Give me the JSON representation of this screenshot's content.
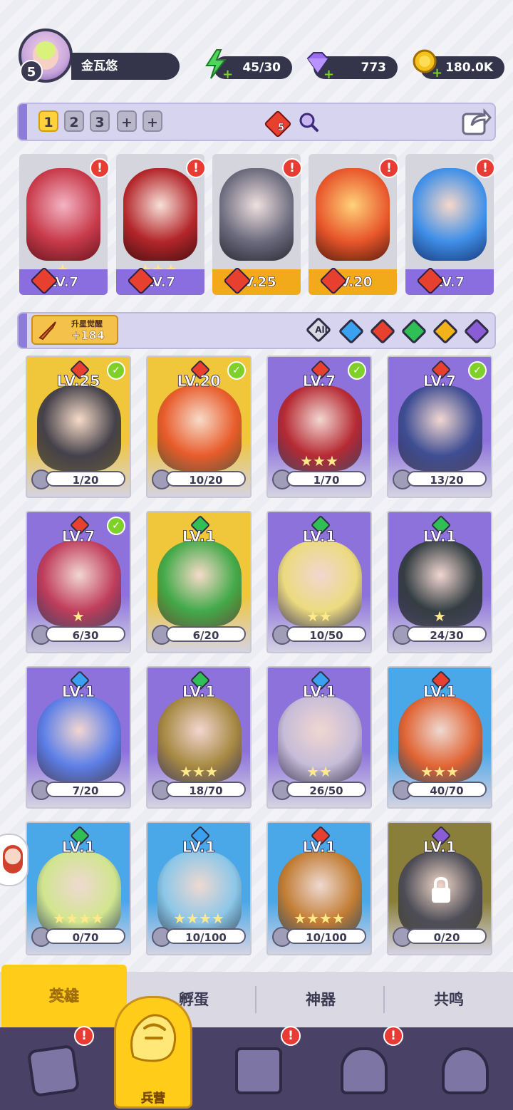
{
  "player": {
    "level": "5",
    "name": "金瓦悠"
  },
  "resources": {
    "energy": "45/30",
    "gems": "773",
    "gold": "180.0K"
  },
  "team_bar": {
    "tabs": [
      "1",
      "2",
      "3",
      "+",
      "+"
    ],
    "active_tab": "1",
    "fire_element_count": "5"
  },
  "team_heroes": [
    {
      "level": "LV.7",
      "bar": "purple",
      "color": "#c83a4a",
      "stars": "★",
      "alert": "!"
    },
    {
      "level": "LV.7",
      "bar": "purple",
      "color": "#b3262a",
      "stars": "★★★",
      "alert": "!"
    },
    {
      "level": "LV.25",
      "bar": "gold",
      "color": "#6b6b7d",
      "stars": "",
      "alert": "!"
    },
    {
      "level": "LV.20",
      "bar": "gold",
      "color": "#e8562a",
      "stars": "",
      "alert": "!"
    },
    {
      "level": "LV.7",
      "bar": "purple",
      "color": "#3f8fe8",
      "stars": "",
      "alert": "!"
    }
  ],
  "awaken": {
    "label": "升星觉醒",
    "value": "+184"
  },
  "filters": [
    {
      "label": "All",
      "color": "#d9d8e3"
    },
    {
      "label": "",
      "color": "#3aa0f0"
    },
    {
      "label": "",
      "color": "#e8402f"
    },
    {
      "label": "",
      "color": "#2fbf55"
    },
    {
      "label": "",
      "color": "#f2b21a"
    },
    {
      "label": "",
      "color": "#8a5cd6"
    }
  ],
  "heroes": [
    {
      "level": "LV.25",
      "progress": "1/20",
      "element": "#e8402f",
      "bg": "#f0c63b",
      "art": "#3b3a4a",
      "check": true,
      "stars": ""
    },
    {
      "level": "LV.20",
      "progress": "10/20",
      "element": "#e8402f",
      "bg": "#f0c63b",
      "art": "#e8562a",
      "check": true,
      "stars": ""
    },
    {
      "level": "LV.7",
      "progress": "1/70",
      "element": "#e8402f",
      "bg": "#8d72dc",
      "art": "#b8262a",
      "check": true,
      "stars": "★★★"
    },
    {
      "level": "LV.7",
      "progress": "13/20",
      "element": "#e8402f",
      "bg": "#8d72dc",
      "art": "#3a4b8f",
      "check": true,
      "stars": ""
    },
    {
      "level": "LV.7",
      "progress": "6/30",
      "element": "#e8402f",
      "bg": "#8d72dc",
      "art": "#c23a55",
      "check": true,
      "stars": "★"
    },
    {
      "level": "LV.1",
      "progress": "6/20",
      "element": "#2fbf55",
      "bg": "#f0c63b",
      "art": "#3aa84a",
      "check": false,
      "stars": ""
    },
    {
      "level": "LV.1",
      "progress": "10/50",
      "element": "#2fbf55",
      "bg": "#8d72dc",
      "art": "#f0e07a",
      "check": false,
      "stars": "★★"
    },
    {
      "level": "LV.1",
      "progress": "24/30",
      "element": "#2fbf55",
      "bg": "#8d72dc",
      "art": "#2f3b3a",
      "check": false,
      "stars": "★"
    },
    {
      "level": "LV.1",
      "progress": "7/20",
      "element": "#3aa0f0",
      "bg": "#8d72dc",
      "art": "#5a7fe8",
      "check": false,
      "stars": ""
    },
    {
      "level": "LV.1",
      "progress": "18/70",
      "element": "#2fbf55",
      "bg": "#8d72dc",
      "art": "#a88a3a",
      "check": false,
      "stars": "★★★"
    },
    {
      "level": "LV.1",
      "progress": "26/50",
      "element": "#3aa0f0",
      "bg": "#8d72dc",
      "art": "#c8c0d8",
      "check": false,
      "stars": "★★"
    },
    {
      "level": "LV.1",
      "progress": "40/70",
      "element": "#e8402f",
      "bg": "#4aa8e8",
      "art": "#e8602a",
      "check": false,
      "stars": "★★★"
    },
    {
      "level": "LV.1",
      "progress": "0/70",
      "element": "#2fbf55",
      "bg": "#4aa8e8",
      "art": "#d8e88a",
      "check": false,
      "stars": "★★★★"
    },
    {
      "level": "LV.1",
      "progress": "10/100",
      "element": "#3aa0f0",
      "bg": "#4aa8e8",
      "art": "#8fc8e8",
      "check": false,
      "stars": "★★★★"
    },
    {
      "level": "LV.1",
      "progress": "10/100",
      "element": "#e8402f",
      "bg": "#4aa8e8",
      "art": "#c87a2a",
      "check": false,
      "stars": "★★★★"
    },
    {
      "level": "LV.1",
      "progress": "0/20",
      "element": "#8a5cd6",
      "bg": "#8a7f3a",
      "art": "#4a4a58",
      "check": false,
      "stars": "",
      "locked": true
    }
  ],
  "subtabs": [
    "英雄",
    "孵蛋",
    "神器",
    "共鸣"
  ],
  "bottom_nav": {
    "items": [
      {
        "icon": "cards-icon",
        "label": "",
        "alert": "!"
      },
      {
        "icon": "barracks-icon",
        "label": "兵营",
        "alert": ""
      },
      {
        "icon": "map-book-icon",
        "label": "",
        "alert": "!"
      },
      {
        "icon": "castle-icon",
        "label": "",
        "alert": "!"
      },
      {
        "icon": "mushroom-icon",
        "label": "",
        "alert": ""
      }
    ]
  },
  "colors": {
    "accent": "#ffcc1a",
    "purple": "#8a6ee0",
    "dark": "#34344a"
  }
}
